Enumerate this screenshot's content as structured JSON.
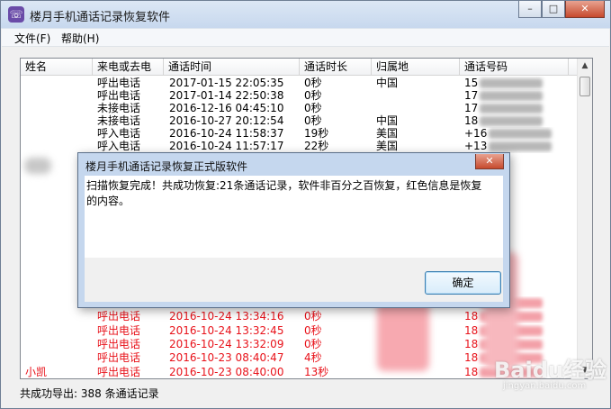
{
  "window": {
    "title": "楼月手机通话记录恢复软件",
    "app_icon_glyph": "☏"
  },
  "window_buttons": {
    "minimize": "–",
    "maximize": "□",
    "close": "✕"
  },
  "menu": [
    {
      "label": "文件(F)"
    },
    {
      "label": "帮助(H)"
    }
  ],
  "table": {
    "columns": [
      "姓名",
      "来电或去电",
      "通话时间",
      "通话时长",
      "归属地",
      "通话号码"
    ],
    "top_rows": [
      {
        "name": "",
        "type": "呼出电话",
        "time": "2017-01-15 22:05:35",
        "duration": "0秒",
        "location": "中国",
        "number": "15"
      },
      {
        "name": "",
        "type": "呼出电话",
        "time": "2017-01-14 22:50:38",
        "duration": "0秒",
        "location": "",
        "number": "17"
      },
      {
        "name": "",
        "type": "未接电话",
        "time": "2016-12-16 04:45:10",
        "duration": "0秒",
        "location": "",
        "number": "17"
      },
      {
        "name": "",
        "type": "未接电话",
        "time": "2016-10-27 20:12:54",
        "duration": "0秒",
        "location": "中国",
        "number": "18"
      },
      {
        "name": "",
        "type": "呼入电话",
        "time": "2016-10-24 11:58:37",
        "duration": "19秒",
        "location": "美国",
        "number": "+16"
      },
      {
        "name": "",
        "type": "呼入电话",
        "time": "2016-10-24 11:57:17",
        "duration": "22秒",
        "location": "美国",
        "number": "+13"
      }
    ],
    "bottom_rows": [
      {
        "name": "",
        "type": "呼出电话",
        "time": "2016-10-24 13:34:39",
        "duration": "0秒",
        "location": "",
        "number": "13"
      },
      {
        "name": "",
        "type": "呼出电话",
        "time": "2016-10-24 13:34:16",
        "duration": "0秒",
        "location": "",
        "number": "18"
      },
      {
        "name": "",
        "type": "呼出电话",
        "time": "2016-10-24 13:32:45",
        "duration": "0秒",
        "location": "",
        "number": "18"
      },
      {
        "name": "",
        "type": "呼出电话",
        "time": "2016-10-24 13:32:09",
        "duration": "0秒",
        "location": "",
        "number": "18"
      },
      {
        "name": "",
        "type": "呼出电话",
        "time": "2016-10-23 08:40:47",
        "duration": "4秒",
        "location": "",
        "number": "18"
      },
      {
        "name": "小凯",
        "type": "呼出电话",
        "time": "2016-10-23 08:40:00",
        "duration": "13秒",
        "location": "",
        "number": "18"
      }
    ]
  },
  "status": {
    "text": "共成功导出: 388 条通话记录"
  },
  "dialog": {
    "title": "楼月手机通话记录恢复正式版软件",
    "close": "✕",
    "message": "扫描恢复完成！共成功恢复:21条通话记录，软件非百分之百恢复，红色信息是恢复的内容。",
    "ok_label": "确定"
  },
  "watermark": {
    "main": "Baidu经验",
    "sub": "jingyan.baidu.com"
  },
  "colors": {
    "recovered_text": "#e8121a",
    "normal_text": "#000000"
  }
}
